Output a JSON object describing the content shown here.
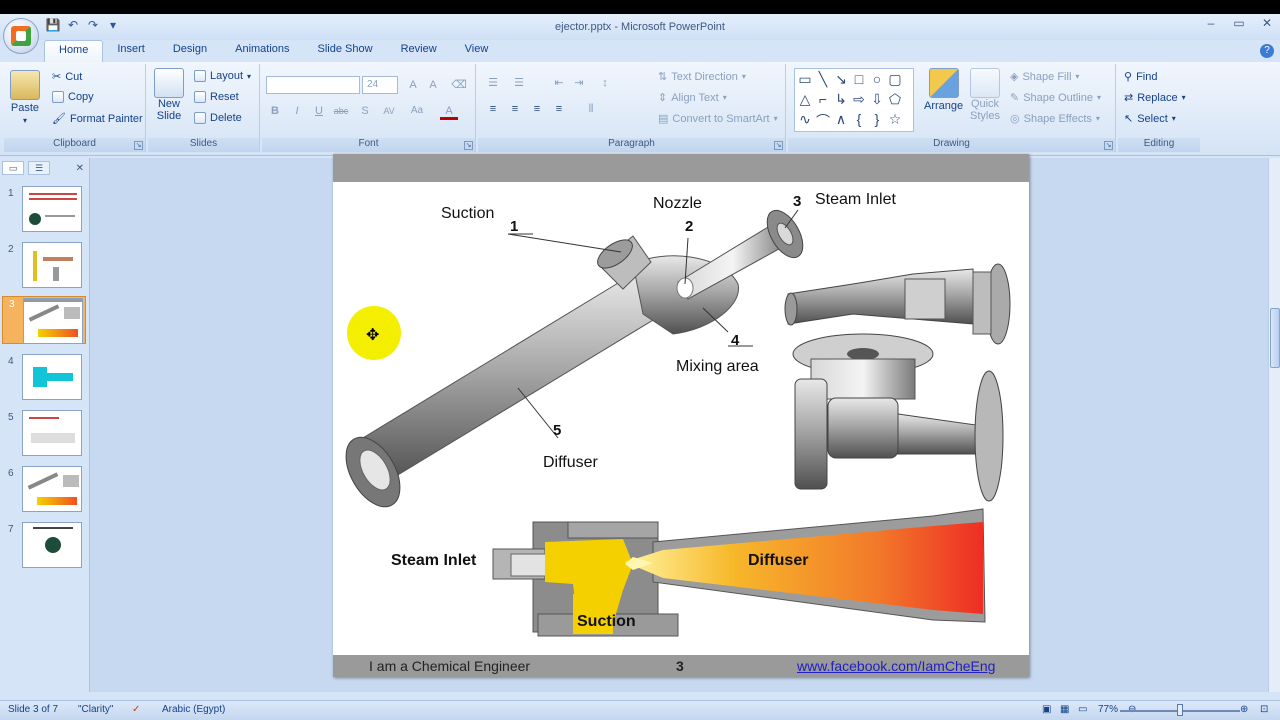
{
  "window": {
    "title": "ejector.pptx - Microsoft PowerPoint",
    "controls": [
      "–",
      "▭",
      "✕"
    ]
  },
  "tabs": [
    "Home",
    "Insert",
    "Design",
    "Animations",
    "Slide Show",
    "Review",
    "View"
  ],
  "ribbon": {
    "clipboard": {
      "label": "Clipboard",
      "paste": "Paste",
      "cut": "Cut",
      "copy": "Copy",
      "format_painter": "Format Painter"
    },
    "slides": {
      "label": "Slides",
      "new_slide": "New",
      "new_slide_2": "Slide",
      "layout": "Layout",
      "reset": "Reset",
      "delete": "Delete"
    },
    "font": {
      "label": "Font",
      "font_name": "",
      "font_size": "24",
      "bold": "B",
      "italic": "I",
      "underline": "U",
      "strike": "abc",
      "shadow": "S",
      "spacing": "AV",
      "case": "Aa",
      "color": "A"
    },
    "paragraph": {
      "label": "Paragraph",
      "text_direction": "Text Direction",
      "align_text": "Align Text",
      "convert_smartart": "Convert to SmartArt"
    },
    "drawing": {
      "label": "Drawing",
      "arrange": "Arrange",
      "quick_styles": "Quick",
      "quick_styles_2": "Styles",
      "shape_fill": "Shape Fill",
      "shape_outline": "Shape Outline",
      "shape_effects": "Shape Effects"
    },
    "editing": {
      "label": "Editing",
      "find": "Find",
      "replace": "Replace",
      "select": "Select"
    }
  },
  "thumbnails": [
    "1",
    "2",
    "3",
    "4",
    "5",
    "6",
    "7"
  ],
  "slide": {
    "labels": {
      "suction": "Suction",
      "nozzle": "Nozzle",
      "steam_inlet": "Steam Inlet",
      "mixing_area": "Mixing area",
      "diffuser": "Diffuser",
      "n1": "1",
      "n2": "2",
      "n3": "3",
      "n4": "4",
      "n5": "5"
    },
    "section": {
      "steam_inlet": "Steam Inlet",
      "diffuser": "Diffuser",
      "suction": "Suction"
    },
    "footer": {
      "left": "I am a Chemical Engineer",
      "page": "3",
      "link": "www.facebook.com/IamCheEng"
    }
  },
  "status": {
    "slide_info": "Slide 3 of 7",
    "theme": "\"Clarity\"",
    "language": "Arabic (Egypt)",
    "zoom": "77%"
  }
}
